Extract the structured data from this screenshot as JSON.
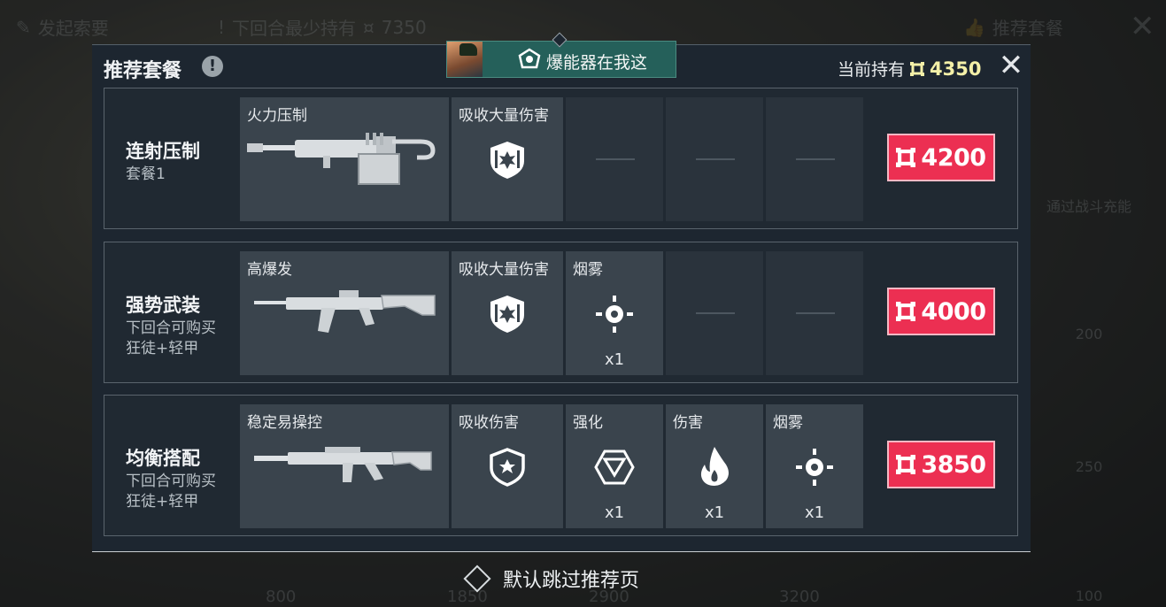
{
  "background": {
    "top_left": "发起索要",
    "top_mid_label": "下回合最少持有",
    "top_mid_amount": "7350",
    "top_right": "推荐套餐",
    "side_text": "通过战斗充能",
    "side_prices": [
      "200",
      "250",
      "100"
    ],
    "bottom_prices": [
      "800",
      "1850",
      "2900",
      "3200"
    ]
  },
  "banner": {
    "text": "爆能器在我这"
  },
  "modal": {
    "title": "推荐套餐",
    "holding_label": "当前持有",
    "holding_amount": "4350"
  },
  "packages": [
    {
      "name": "连射压制",
      "subtitle_lines": [
        "套餐1"
      ],
      "weapon_label": "火力压制",
      "items": [
        {
          "label": "吸收大量伤害",
          "icon": "heavy-shield-icon",
          "qty": ""
        },
        {
          "label": "",
          "icon": "",
          "qty": ""
        },
        {
          "label": "",
          "icon": "",
          "qty": ""
        },
        {
          "label": "",
          "icon": "",
          "qty": ""
        }
      ],
      "price": "4200"
    },
    {
      "name": "强势武装",
      "subtitle_lines": [
        "下回合可购买",
        "狂徒+轻甲"
      ],
      "weapon_label": "高爆发",
      "items": [
        {
          "label": "吸收大量伤害",
          "icon": "heavy-shield-icon",
          "qty": ""
        },
        {
          "label": "烟雾",
          "icon": "smoke-icon",
          "qty": "x1"
        },
        {
          "label": "",
          "icon": "",
          "qty": ""
        },
        {
          "label": "",
          "icon": "",
          "qty": ""
        }
      ],
      "price": "4000"
    },
    {
      "name": "均衡搭配",
      "subtitle_lines": [
        "下回合可购买",
        "狂徒+轻甲"
      ],
      "weapon_label": "稳定易操控",
      "items": [
        {
          "label": "吸收伤害",
          "icon": "light-shield-icon",
          "qty": ""
        },
        {
          "label": "强化",
          "icon": "enhance-icon",
          "qty": "x1"
        },
        {
          "label": "伤害",
          "icon": "fire-icon",
          "qty": "x1"
        },
        {
          "label": "烟雾",
          "icon": "smoke-icon",
          "qty": "x1"
        }
      ],
      "price": "3850"
    }
  ],
  "skip_label": "默认跳过推荐页",
  "colors": {
    "price_button": "#ec2f52",
    "banner_bg": "#25605a",
    "holding_amount": "#f4f0a8"
  }
}
